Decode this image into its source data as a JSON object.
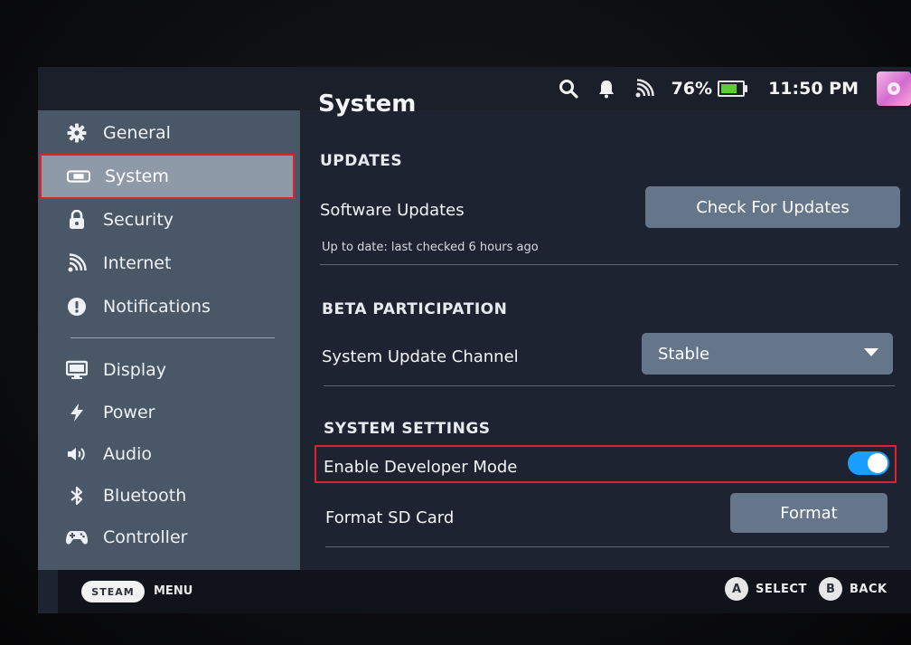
{
  "status": {
    "battery_percent_text": "76%",
    "battery_level": 0.76,
    "battery_color": "#58d12d",
    "time": "11:50 PM",
    "icons": [
      "search-icon",
      "bell-icon",
      "wifi-icon",
      "battery-icon",
      "avatar"
    ]
  },
  "sidebar": {
    "items": [
      {
        "label": "General",
        "icon": "gear-icon"
      },
      {
        "label": "System",
        "icon": "system-icon",
        "active": true
      },
      {
        "label": "Security",
        "icon": "lock-icon"
      },
      {
        "label": "Internet",
        "icon": "wifi-icon"
      },
      {
        "label": "Notifications",
        "icon": "alert-icon"
      },
      {
        "label": "Display",
        "icon": "monitor-icon"
      },
      {
        "label": "Power",
        "icon": "bolt-icon"
      },
      {
        "label": "Audio",
        "icon": "speaker-icon"
      },
      {
        "label": "Bluetooth",
        "icon": "bluetooth-icon"
      },
      {
        "label": "Controller",
        "icon": "gamepad-icon"
      }
    ]
  },
  "main": {
    "title": "System",
    "updates": {
      "header": "UPDATES",
      "software_label": "Software Updates",
      "status": "Up to date: last checked 6 hours ago",
      "check_button": "Check For Updates"
    },
    "beta": {
      "header": "BETA PARTICIPATION",
      "channel_label": "System Update Channel",
      "channel_value": "Stable"
    },
    "system_settings": {
      "header": "SYSTEM SETTINGS",
      "dev_mode_label": "Enable Developer Mode",
      "dev_mode_on": true,
      "format_label": "Format SD Card",
      "format_button": "Format"
    }
  },
  "footer": {
    "steam_label": "STEAM",
    "menu_label": "MENU",
    "a_button": "A",
    "select_label": "SELECT",
    "b_button": "B",
    "back_label": "BACK"
  },
  "colors": {
    "accent": "#1a9fff",
    "highlight_box": "#e0202a",
    "sidebar_active": "#8e9aa8"
  }
}
